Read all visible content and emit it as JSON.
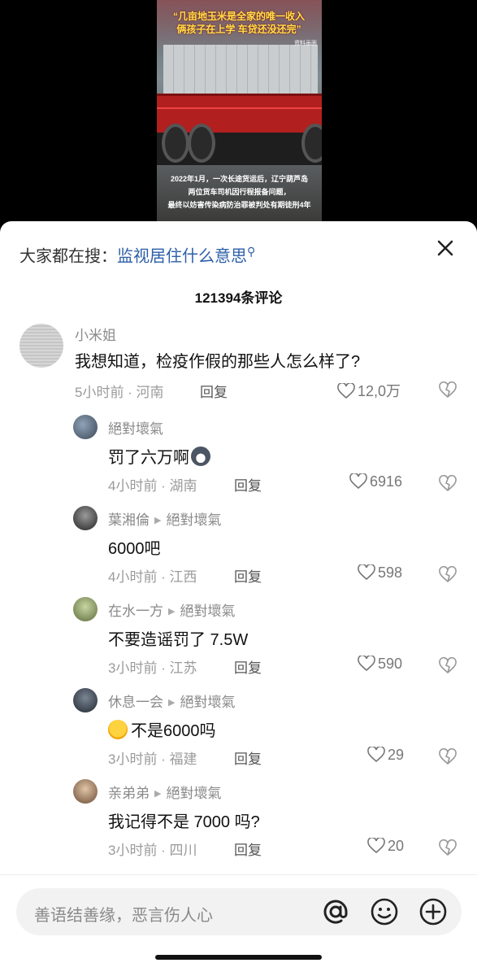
{
  "video": {
    "quote": "“几亩地玉米是全家的唯一收入\n俩孩子在上学 车贷还没还完”",
    "credit": "资料画面",
    "caption": "2022年1月，一次长途货运后，辽宁葫芦岛\n两位货车司机因行程报备问题，\n最终以妨害传染病防治罪被判处有期徒刑4年"
  },
  "search": {
    "label": "大家都在搜：",
    "query": "监视居住什么意思"
  },
  "comment_count": "121394条评论",
  "comments": [
    {
      "user": "小米姐",
      "reply_to": "",
      "text": "我想知道，检疫作假的那些人怎么样了?",
      "emoji": "",
      "meta": "5小时前 · 河南",
      "reply": "回复",
      "likes": "12,0万"
    },
    {
      "user": "絕對壞氣",
      "reply_to": "",
      "text": "罚了六万啊",
      "emoji": "cat-face",
      "meta": "4小时前 · 湖南",
      "reply": "回复",
      "likes": "6916"
    },
    {
      "user": "葉湘倫",
      "reply_to": "絕對壞氣",
      "text": "6000吧",
      "emoji": "",
      "meta": "4小时前 · 江西",
      "reply": "回复",
      "likes": "598"
    },
    {
      "user": "在水一方",
      "reply_to": "絕對壞氣",
      "text": "不要造谣罚了 7.5W",
      "emoji": "",
      "meta": "3小时前 · 江苏",
      "reply": "回复",
      "likes": "590"
    },
    {
      "user": "休息一会",
      "reply_to": "絕對壞氣",
      "text": "不是6000吗",
      "emoji": "laughing-face",
      "meta": "3小时前 · 福建",
      "reply": "回复",
      "likes": "29"
    },
    {
      "user": "亲弟弟",
      "reply_to": "絕對壞氣",
      "text": "我记得不是 7000 吗?",
      "emoji": "",
      "meta": "3小时前 · 四川",
      "reply": "回复",
      "likes": "20"
    }
  ],
  "input": {
    "placeholder": "善语结善缘，恶言伤人心"
  },
  "icons": [
    "close-icon",
    "search-icon",
    "heart-icon",
    "broken-heart-icon",
    "at-icon",
    "emoji-icon",
    "plus-icon"
  ],
  "colors": {
    "link": "#2c5fa8",
    "meta": "#9b9b9b",
    "text": "#111111"
  }
}
